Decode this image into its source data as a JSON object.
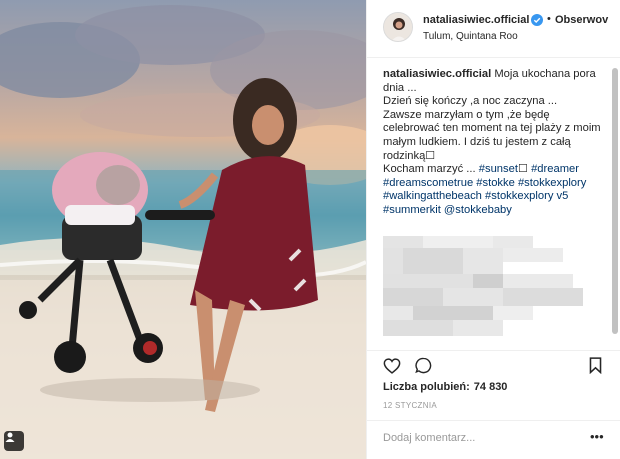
{
  "post": {
    "username": "nataliasiwiec.official",
    "follow_label": "Obserwov",
    "separator": "•",
    "location": "Tulum, Quintana Roo"
  },
  "caption": {
    "username": "nataliasiwiec.official",
    "line1": "Moja ukochana pora dnia ...",
    "line2": "Dzień się kończy ,a noc zaczyna ...",
    "line3": "Zawsze marzyłam o tym ,że będę celebrować ten moment na tej plaży z moim małym ludkiem. I dziś tu jestem z całą rodzinką",
    "line4_text": "Kocham marzyć ... ",
    "hashtags": [
      "#sunset",
      "#dreamer",
      "#dreamscometrue",
      "#stokke",
      "#stokkexplory",
      "#walkingatthebeach",
      "#stokkexplory v5",
      "#summerkit",
      "@stokkebaby"
    ]
  },
  "likes": {
    "label": "Liczba polubień:",
    "count": "74 830"
  },
  "date": "12 STYCZNIA",
  "comment": {
    "placeholder": "Dodaj komentarz...",
    "more": "•••"
  },
  "icons": {
    "verified": "verified-badge-icon",
    "like": "heart-icon",
    "comment": "comment-icon",
    "save": "bookmark-icon",
    "tag": "person-tag-icon"
  },
  "colors": {
    "hashtag": "#003569",
    "verified": "#3897f0",
    "muted": "#999999"
  }
}
